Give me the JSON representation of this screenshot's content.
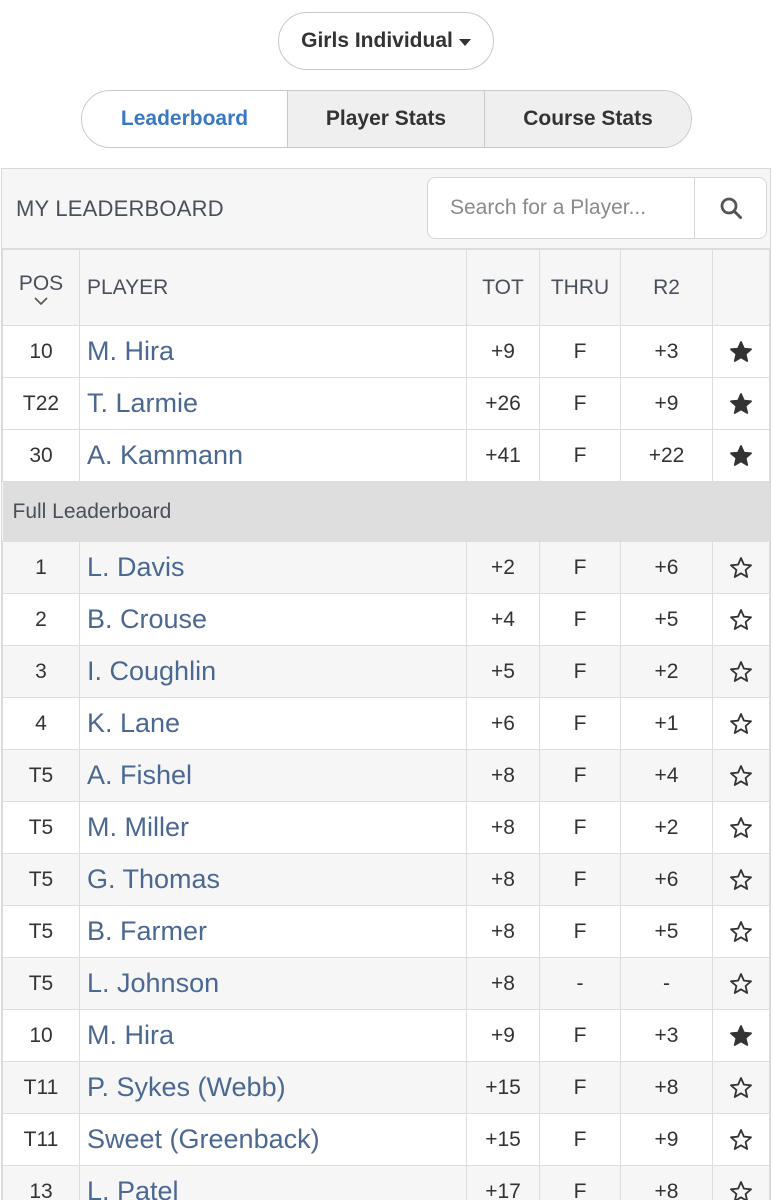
{
  "division_select": {
    "label": "Girls Individual"
  },
  "tabs": [
    {
      "label": "Leaderboard",
      "active": true
    },
    {
      "label": "Player Stats",
      "active": false
    },
    {
      "label": "Course Stats",
      "active": false
    }
  ],
  "my_leaderboard": {
    "title": "MY LEADERBOARD",
    "search_placeholder": "Search for a Player..."
  },
  "columns": {
    "pos": "POS",
    "player": "PLAYER",
    "tot": "TOT",
    "thru": "THRU",
    "r2": "R2"
  },
  "my_rows": [
    {
      "pos": "10",
      "player": "M. Hira",
      "tot": "+9",
      "thru": "F",
      "r2": "+3",
      "starred": true
    },
    {
      "pos": "T22",
      "player": "T. Larmie",
      "tot": "+26",
      "thru": "F",
      "r2": "+9",
      "starred": true
    },
    {
      "pos": "30",
      "player": "A. Kammann",
      "tot": "+41",
      "thru": "F",
      "r2": "+22",
      "starred": true
    }
  ],
  "full_section_label": "Full Leaderboard",
  "full_rows": [
    {
      "pos": "1",
      "player": "L. Davis",
      "tot": "+2",
      "thru": "F",
      "r2": "+6",
      "starred": false
    },
    {
      "pos": "2",
      "player": "B. Crouse",
      "tot": "+4",
      "thru": "F",
      "r2": "+5",
      "starred": false
    },
    {
      "pos": "3",
      "player": "I. Coughlin",
      "tot": "+5",
      "thru": "F",
      "r2": "+2",
      "starred": false
    },
    {
      "pos": "4",
      "player": "K. Lane",
      "tot": "+6",
      "thru": "F",
      "r2": "+1",
      "starred": false
    },
    {
      "pos": "T5",
      "player": "A. Fishel",
      "tot": "+8",
      "thru": "F",
      "r2": "+4",
      "starred": false
    },
    {
      "pos": "T5",
      "player": "M. Miller",
      "tot": "+8",
      "thru": "F",
      "r2": "+2",
      "starred": false
    },
    {
      "pos": "T5",
      "player": "G. Thomas",
      "tot": "+8",
      "thru": "F",
      "r2": "+6",
      "starred": false
    },
    {
      "pos": "T5",
      "player": "B. Farmer",
      "tot": "+8",
      "thru": "F",
      "r2": "+5",
      "starred": false
    },
    {
      "pos": "T5",
      "player": "L. Johnson",
      "tot": "+8",
      "thru": "-",
      "r2": "-",
      "starred": false
    },
    {
      "pos": "10",
      "player": "M. Hira",
      "tot": "+9",
      "thru": "F",
      "r2": "+3",
      "starred": true
    },
    {
      "pos": "T11",
      "player": "P. Sykes (Webb)",
      "tot": "+15",
      "thru": "F",
      "r2": "+8",
      "starred": false
    },
    {
      "pos": "T11",
      "player": "Sweet (Greenback)",
      "tot": "+15",
      "thru": "F",
      "r2": "+9",
      "starred": false
    },
    {
      "pos": "13",
      "player": "L. Patel",
      "tot": "+17",
      "thru": "F",
      "r2": "+8",
      "starred": false
    }
  ],
  "colors": {
    "accent": "#3b78c4",
    "player_link": "#4a6892",
    "section_bg": "#dedede"
  },
  "icons": {
    "search": "search-icon",
    "star_filled": "star-filled-icon",
    "star_outline": "star-outline-icon",
    "sort": "chevron-down-icon",
    "dropdown": "caret-down-icon"
  }
}
